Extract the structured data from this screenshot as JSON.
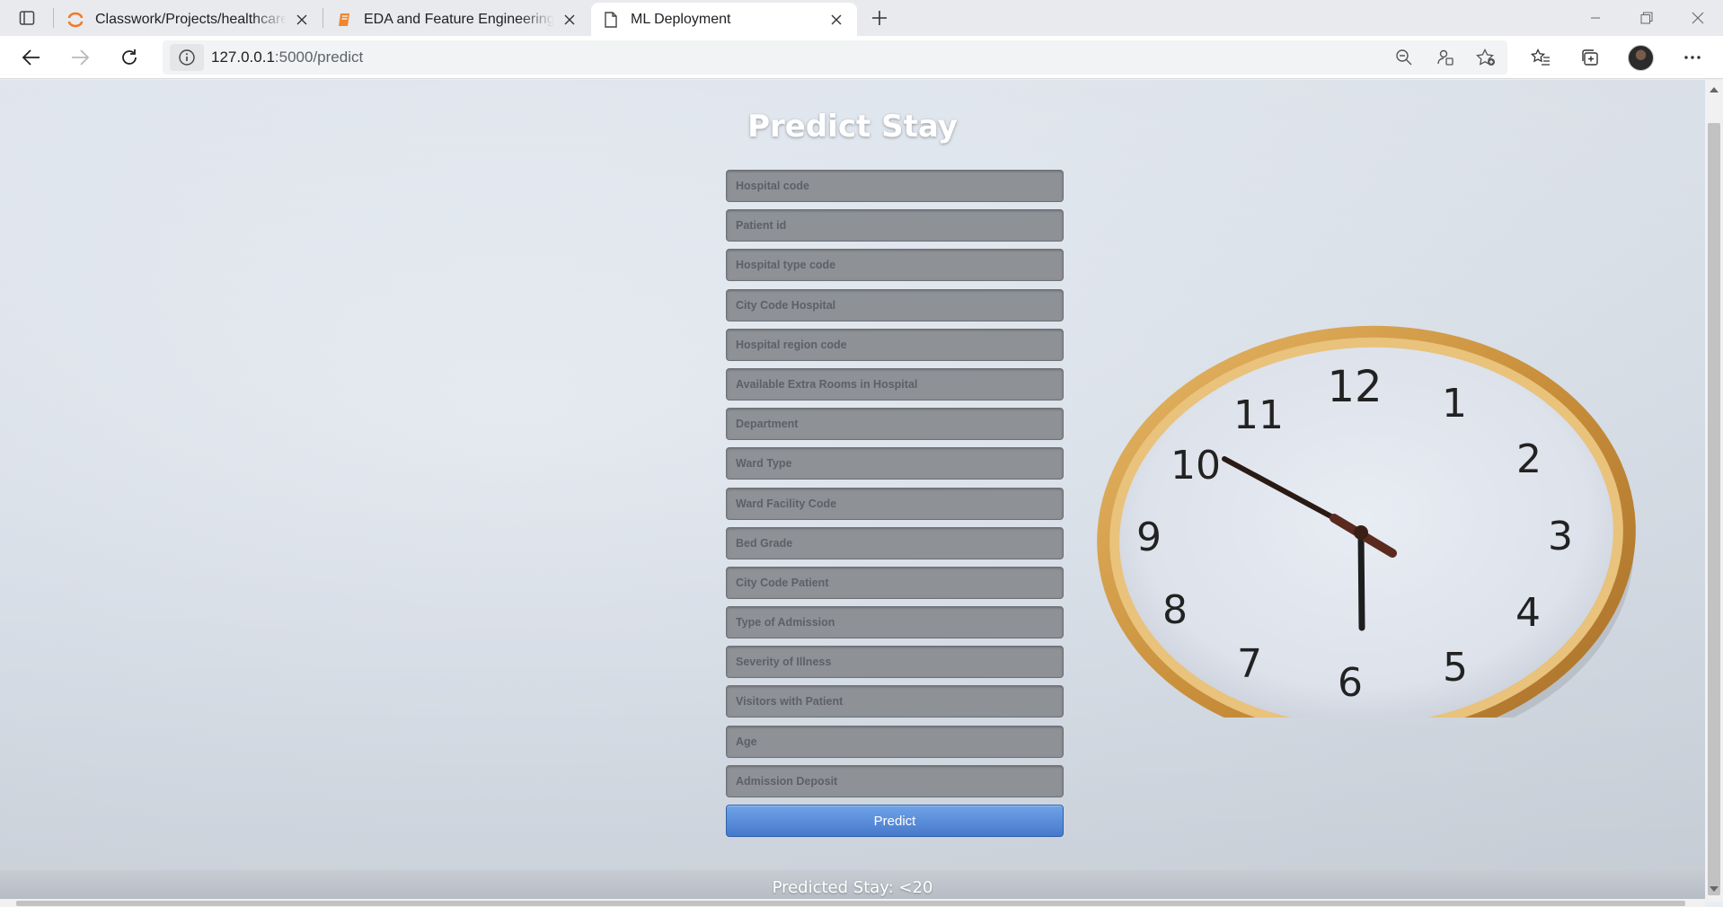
{
  "browser": {
    "tabs": [
      {
        "title": "Classwork/Projects/healthcare/ar",
        "icon": "jupyter-icon",
        "active": false
      },
      {
        "title": "EDA and Feature Engineering2 -",
        "icon": "notebook-icon",
        "active": false
      },
      {
        "title": "ML Deployment",
        "icon": "page-icon",
        "active": true
      }
    ],
    "url_host": "127.0.0.1",
    "url_path": ":5000/predict"
  },
  "page": {
    "title": "Predict Stay",
    "fields": [
      {
        "placeholder": "Hospital code"
      },
      {
        "placeholder": "Patient id"
      },
      {
        "placeholder": "Hospital type code"
      },
      {
        "placeholder": "City Code Hospital"
      },
      {
        "placeholder": "Hospital region code"
      },
      {
        "placeholder": "Available Extra Rooms in Hospital"
      },
      {
        "placeholder": "Department"
      },
      {
        "placeholder": "Ward Type"
      },
      {
        "placeholder": "Ward Facility Code"
      },
      {
        "placeholder": "Bed Grade"
      },
      {
        "placeholder": "City Code Patient"
      },
      {
        "placeholder": "Type of Admission"
      },
      {
        "placeholder": "Severity of Illness"
      },
      {
        "placeholder": "Visitors with Patient"
      },
      {
        "placeholder": "Age"
      },
      {
        "placeholder": "Admission Deposit"
      }
    ],
    "button_label": "Predict",
    "result_text": "Predicted Stay: <20",
    "clock_numbers": [
      "12",
      "1",
      "2",
      "3",
      "4",
      "5",
      "6",
      "7",
      "8",
      "9",
      "10",
      "11"
    ]
  },
  "colors": {
    "field_bg": "#8e9196",
    "button": "#4779cb",
    "clock_frame": "#d5a052"
  }
}
